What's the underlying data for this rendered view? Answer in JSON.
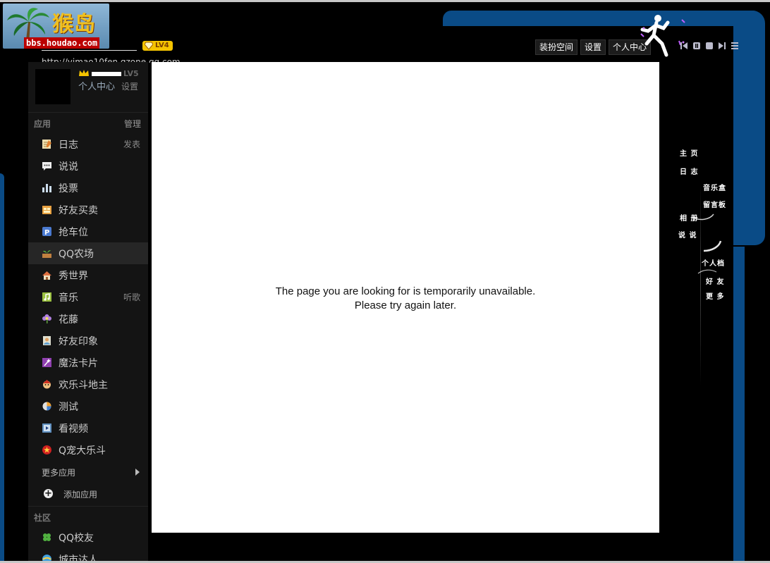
{
  "header": {
    "logo_site_name": "猴岛",
    "logo_url": "bbs.houdao.com",
    "owner_level_badge": "LV4",
    "url_fragment": "http://yimao10fen.qzone.qq.com",
    "buttons": {
      "dress_up": "装扮空间",
      "settings": "设置",
      "personal_center": "个人中心"
    },
    "player_controls": [
      "prev-icon",
      "pause-icon",
      "stop-icon",
      "next-icon",
      "menu-icon"
    ]
  },
  "sidebar": {
    "level": "LV5",
    "personal_center": "个人中心",
    "settings": "设置",
    "apps_section": {
      "title": "应用",
      "manage": "管理",
      "items": [
        {
          "label": "日志",
          "action": "发表",
          "icon": "diary-icon"
        },
        {
          "label": "说说",
          "action": "",
          "icon": "speech-bubble-icon"
        },
        {
          "label": "投票",
          "action": "",
          "icon": "bar-chart-icon"
        },
        {
          "label": "好友买卖",
          "action": "",
          "icon": "trade-icon"
        },
        {
          "label": "抢车位",
          "action": "",
          "icon": "parking-icon"
        },
        {
          "label": "QQ农场",
          "action": "",
          "icon": "farm-icon"
        },
        {
          "label": "秀世界",
          "action": "",
          "icon": "house-icon"
        },
        {
          "label": "音乐",
          "action": "听歌",
          "icon": "music-icon"
        },
        {
          "label": "花藤",
          "action": "",
          "icon": "flower-icon"
        },
        {
          "label": "好友印象",
          "action": "",
          "icon": "impression-icon"
        },
        {
          "label": "魔法卡片",
          "action": "",
          "icon": "magic-card-icon"
        },
        {
          "label": "欢乐斗地主",
          "action": "",
          "icon": "landlord-icon"
        },
        {
          "label": "测试",
          "action": "",
          "icon": "pie-chart-icon"
        },
        {
          "label": "看视频",
          "action": "",
          "icon": "video-icon"
        },
        {
          "label": "Q宠大乐斗",
          "action": "",
          "icon": "pet-fight-icon"
        }
      ],
      "more": "更多应用",
      "add": "添加应用"
    },
    "social_section": {
      "title": "社区",
      "items": [
        {
          "label": "QQ校友",
          "icon": "clover-icon"
        },
        {
          "label": "城市达人",
          "icon": "city-icon"
        }
      ]
    }
  },
  "main": {
    "error_line1": "The page you are looking for is temporarily unavailable.",
    "error_line2": "Please try again later."
  },
  "right_nav": {
    "home": "主 页",
    "blog": "日 志",
    "music_box": "音乐盒",
    "guestbook": "留言板",
    "album": "相 册",
    "talk": "说 说",
    "profile": "个人档",
    "friends": "好 友",
    "more": "更 多"
  },
  "colors": {
    "frame_blue": "#0a4b86",
    "background": "#000000",
    "sidebar_bg": "#141414",
    "level_badge": "#f5c400"
  }
}
